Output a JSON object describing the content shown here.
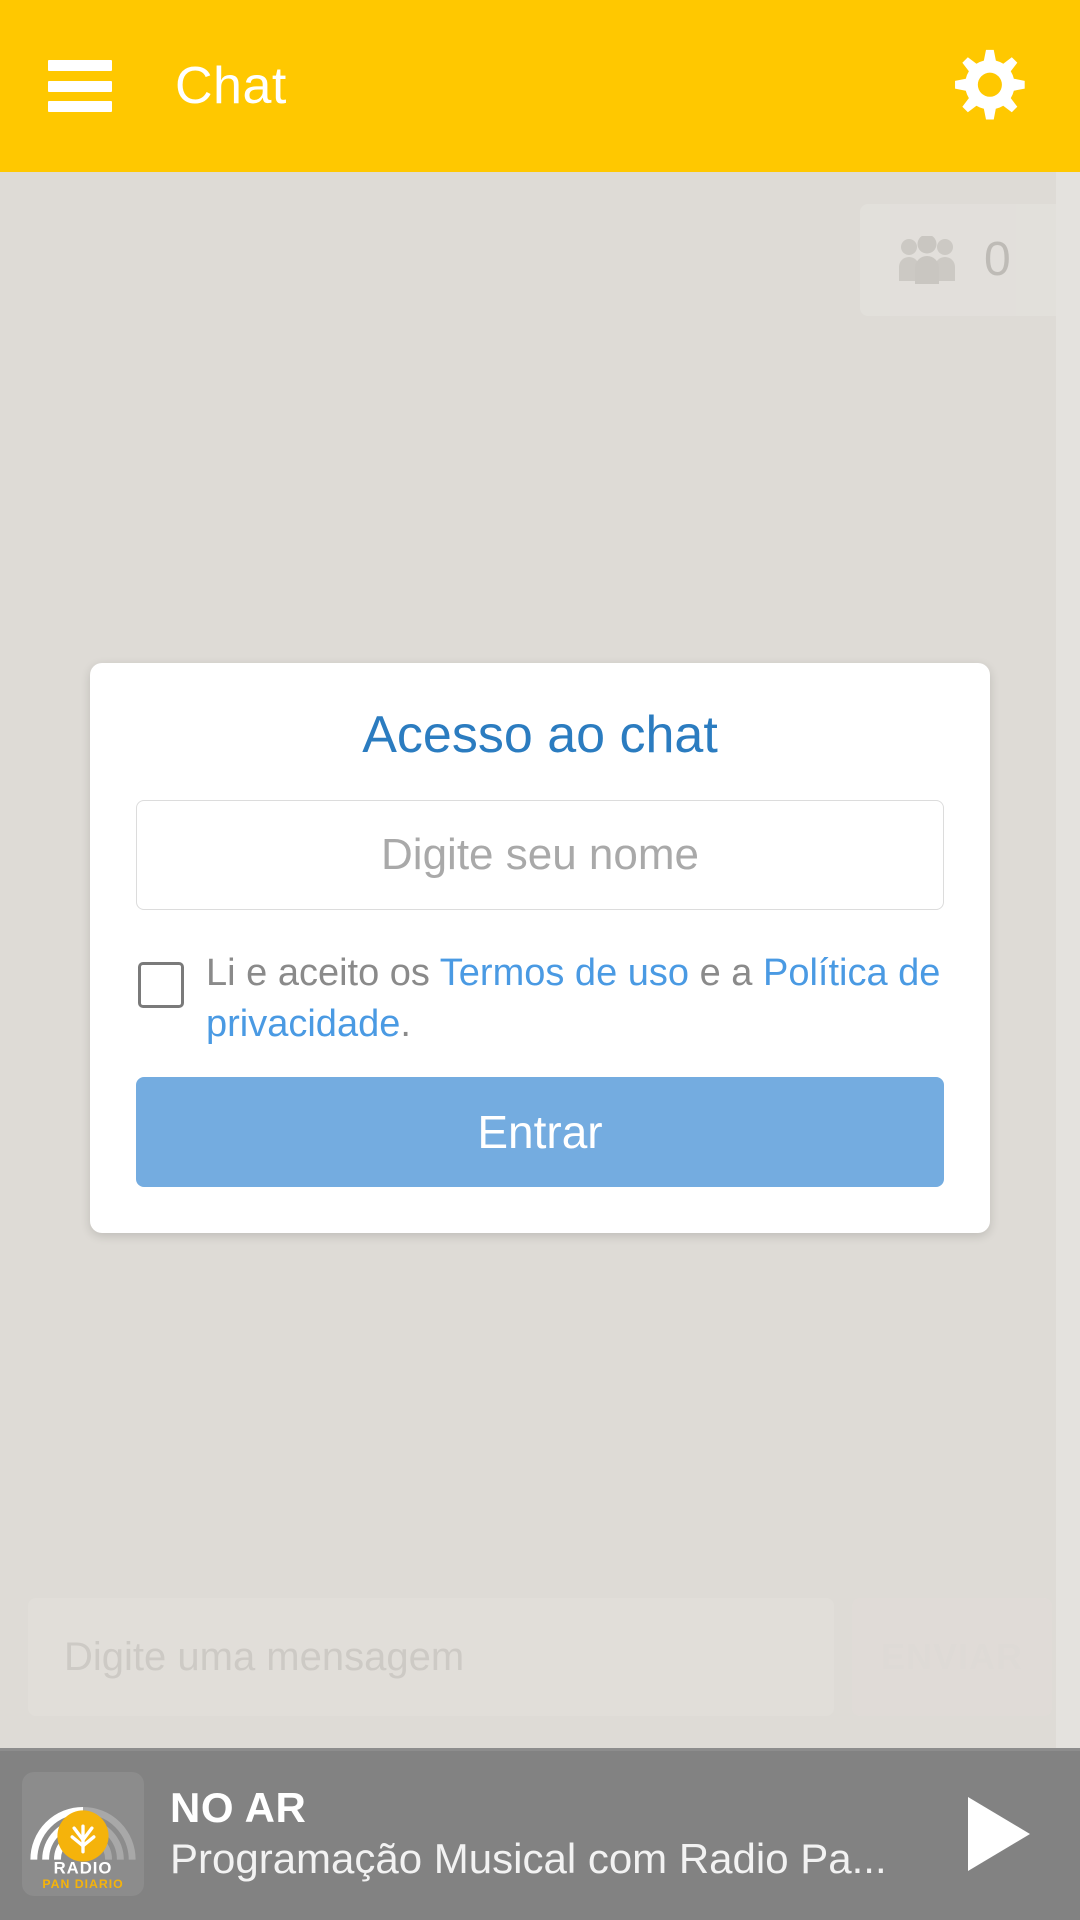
{
  "header": {
    "title": "Chat",
    "menu_icon": "hamburger-menu-icon",
    "settings_icon": "gear-icon",
    "background_color": "#FFC800"
  },
  "chat": {
    "users_badge": {
      "icon": "users-group-icon",
      "count": "0"
    },
    "composer": {
      "placeholder": "Digite uma mensagem",
      "send_label": "ENVIAR"
    }
  },
  "modal": {
    "title": "Acesso ao chat",
    "title_color": "#2B7CC0",
    "name_input": {
      "placeholder": "Digite seu nome",
      "value": ""
    },
    "terms": {
      "checkbox_checked": false,
      "prefix": "Li e aceito os ",
      "link_terms": "Termos de uso",
      "middle": " e a ",
      "link_privacy": "Política de privacidade",
      "suffix": ".",
      "link_color": "#4A9AE3"
    },
    "submit_label": "Entrar",
    "submit_color": "#74ACE0"
  },
  "player": {
    "logo": {
      "icon": "radio-pan-diario-logo",
      "brand_top": "RADIO",
      "brand_bottom": "PAN DIARIO",
      "accent_color": "#F5B30B"
    },
    "status": "NO AR",
    "program": "Programação Musical com Radio Pa...",
    "play_icon": "play-icon",
    "background_color": "#828282"
  }
}
